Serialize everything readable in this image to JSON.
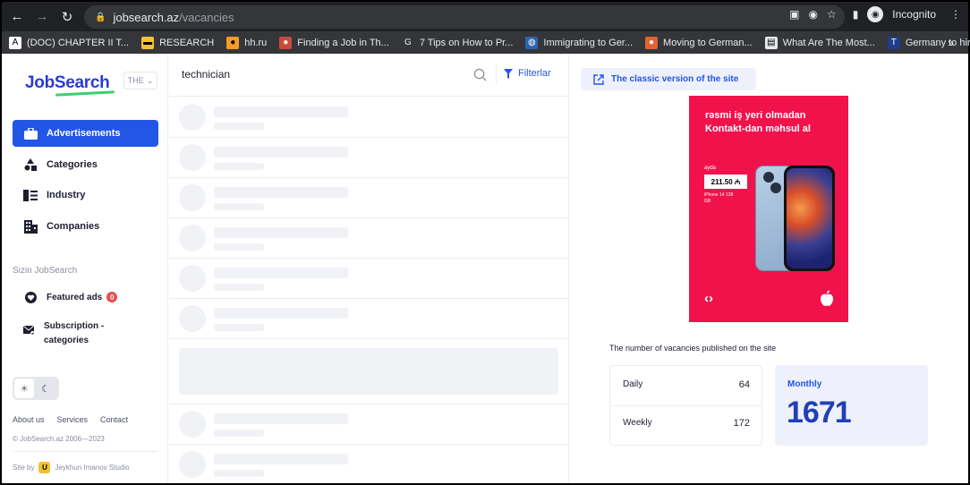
{
  "browser": {
    "url_host": "jobsearch.az",
    "url_path": "/vacancies",
    "profile": "Incognito",
    "bookmarks": [
      {
        "label": "(DOC) CHAPTER II T...",
        "icon": "A",
        "color": "#ffffff",
        "text": "#000"
      },
      {
        "label": "RESEARCH",
        "icon": "folder",
        "color": "#f3c13a",
        "text": "#000"
      },
      {
        "label": "hh.ru",
        "icon": "hh",
        "color": "#f59b2b",
        "text": "#000"
      },
      {
        "label": "Finding a Job in Th...",
        "icon": "job",
        "color": "#c84b3a",
        "text": "#fff"
      },
      {
        "label": "7 Tips on How to Pr...",
        "icon": "G",
        "color": "#35363a",
        "text": "#e8eaed"
      },
      {
        "label": "Immigrating to Ger...",
        "icon": "globe",
        "color": "#2d64b0",
        "text": "#fff"
      },
      {
        "label": "Moving to German...",
        "icon": "firefox",
        "color": "#e1632f",
        "text": "#fff"
      },
      {
        "label": "What Are The Most...",
        "icon": "doc",
        "color": "#e8eaed",
        "text": "#000"
      },
      {
        "label": "Germany to hire Pi...",
        "icon": "TFT",
        "color": "#1f3d8a",
        "text": "#fff"
      }
    ]
  },
  "sidebar": {
    "logo": "JobSearch",
    "lang": "THE",
    "menu": [
      {
        "label": "Advertisements",
        "icon": "briefcase-icon",
        "active": true
      },
      {
        "label": "Categories",
        "icon": "shapes-icon",
        "active": false
      },
      {
        "label": "Industry",
        "icon": "industry-icon",
        "active": false
      },
      {
        "label": "Companies",
        "icon": "building-icon",
        "active": false
      }
    ],
    "section_title": "Sizin JobSearch",
    "featured_ads": "Featured ads",
    "featured_count": "0",
    "subscription": "Subscription - categories",
    "footer_links": [
      "About us",
      "Services",
      "Contact"
    ],
    "copyright": "© JobSearch.az 2006—2023",
    "site_by": "Site by",
    "studio": "Jeykhun Imanov Studio"
  },
  "search": {
    "query": "technician",
    "filter_label": "Filterlar"
  },
  "right": {
    "classic_link": "The classic version of the site",
    "ad": {
      "headline": "rəsmi iş yeri olmadan Kontakt-dan məhsul al",
      "ayda": "ayda",
      "price": "211.50 ₼",
      "model": "iPhone 14 128 GB"
    },
    "stats_title": "The number of vacancies published on the site",
    "daily_label": "Daily",
    "daily_value": "64",
    "weekly_label": "Weekly",
    "weekly_value": "172",
    "monthly_label": "Monthly",
    "monthly_value": "1671"
  },
  "colors": {
    "primary": "#2355e6",
    "ad_background": "#f2124b"
  }
}
